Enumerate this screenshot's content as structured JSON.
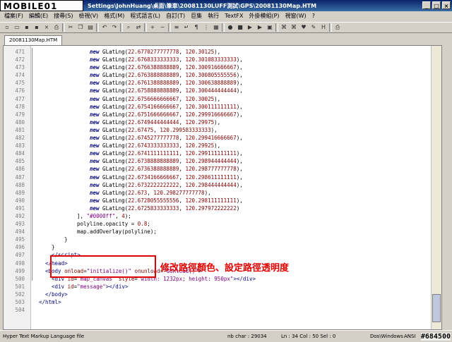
{
  "window": {
    "logo": "MOBILE01",
    "title": "Settings\\JohnHuang\\桌面\\筆車\\20081130LUFF測試\\GPS\\20081130Map.HTM"
  },
  "menu": [
    "檔案(F)",
    "編輯(E)",
    "搜尋(S)",
    "檢視(V)",
    "格式(M)",
    "程式語言(L)",
    "自訂(T)",
    "巨集",
    "執行",
    "TextFX",
    "外掛模組(P)",
    "視窗(W)",
    "?"
  ],
  "tab": {
    "label": "20081130Map.HTM"
  },
  "lines": [
    {
      "n": 471,
      "html": "<span class='kw'>new</span> GLatLng(<span class='num'>22.6770277777778</span>, <span class='num'>120.30125</span>),",
      "indent": 8
    },
    {
      "n": 472,
      "html": "<span class='kw'>new</span> GLatLng(<span class='num'>22.6768333333333</span>, <span class='num'>120.301083333333</span>),",
      "indent": 8
    },
    {
      "n": 473,
      "html": "<span class='kw'>new</span> GLatLng(<span class='num'>22.6766388888889</span>, <span class='num'>120.300916666667</span>),",
      "indent": 8
    },
    {
      "n": 474,
      "html": "<span class='kw'>new</span> GLatLng(<span class='num'>22.6763888888889</span>, <span class='num'>120.300805555556</span>),",
      "indent": 8
    },
    {
      "n": 475,
      "html": "<span class='kw'>new</span> GLatLng(<span class='num'>22.6761388888889</span>, <span class='num'>120.300638888889</span>),",
      "indent": 8
    },
    {
      "n": 476,
      "html": "<span class='kw'>new</span> GLatLng(<span class='num'>22.6758888888889</span>, <span class='num'>120.300444444444</span>),",
      "indent": 8
    },
    {
      "n": 477,
      "html": "<span class='kw'>new</span> GLatLng(<span class='num'>22.6756666666667</span>, <span class='num'>120.30025</span>),",
      "indent": 8
    },
    {
      "n": 478,
      "html": "<span class='kw'>new</span> GLatLng(<span class='num'>22.6754166666667</span>, <span class='num'>120.300111111111</span>),",
      "indent": 8
    },
    {
      "n": 479,
      "html": "<span class='kw'>new</span> GLatLng(<span class='num'>22.6751666666667</span>, <span class='num'>120.299916666667</span>),",
      "indent": 8
    },
    {
      "n": 480,
      "html": "<span class='kw'>new</span> GLatLng(<span class='num'>22.6749444444444</span>, <span class='num'>120.29975</span>),",
      "indent": 8
    },
    {
      "n": 481,
      "html": "<span class='kw'>new</span> GLatLng(<span class='num'>22.67475</span>, <span class='num'>120.299583333333</span>),",
      "indent": 8
    },
    {
      "n": 482,
      "html": "<span class='kw'>new</span> GLatLng(<span class='num'>22.6745277777778</span>, <span class='num'>120.299416666667</span>),",
      "indent": 8
    },
    {
      "n": 483,
      "html": "<span class='kw'>new</span> GLatLng(<span class='num'>22.6743333333333</span>, <span class='num'>120.29925</span>),",
      "indent": 8
    },
    {
      "n": 484,
      "html": "<span class='kw'>new</span> GLatLng(<span class='num'>22.6741111111111</span>, <span class='num'>120.299111111111</span>),",
      "indent": 8
    },
    {
      "n": 485,
      "html": "<span class='kw'>new</span> GLatLng(<span class='num'>22.6738888888889</span>, <span class='num'>120.298944444444</span>),",
      "indent": 8
    },
    {
      "n": 486,
      "html": "<span class='kw'>new</span> GLatLng(<span class='num'>22.6736388888889</span>, <span class='num'>120.298777777778</span>),",
      "indent": 8
    },
    {
      "n": 487,
      "html": "<span class='kw'>new</span> GLatLng(<span class='num'>22.6734166666667</span>, <span class='num'>120.298611111111</span>),",
      "indent": 8
    },
    {
      "n": 488,
      "html": "<span class='kw'>new</span> GLatLng(<span class='num'>22.6732222222222</span>, <span class='num'>120.298444444444</span>),",
      "indent": 8
    },
    {
      "n": 489,
      "html": "<span class='kw'>new</span> GLatLng(<span class='num'>22.673</span>, <span class='num'>120.298277777778</span>),",
      "indent": 8
    },
    {
      "n": 490,
      "html": "<span class='kw'>new</span> GLatLng(<span class='num'>22.6728055555556</span>, <span class='num'>120.298111111111</span>),",
      "indent": 8
    },
    {
      "n": 491,
      "html": "<span class='kw'>new</span> GLatLng(<span class='num'>22.6725833333333</span>, <span class='num'>120.297972222222</span>)",
      "indent": 8
    },
    {
      "n": 492,
      "html": "], <span class='str'>\"#0000ff\"</span>, <span class='num'>4</span>);",
      "indent": 6
    },
    {
      "n": 493,
      "html": "polyline.opacity = <span class='num'>0.8</span>;",
      "indent": 6
    },
    {
      "n": 494,
      "html": "map.addOverlay(polyline);",
      "indent": 6
    },
    {
      "n": 495,
      "html": "}",
      "indent": 4
    },
    {
      "n": 496,
      "html": "}",
      "indent": 2
    },
    {
      "n": 497,
      "html": "<span class='tag'>&lt;/script&gt;</span>",
      "indent": 2
    },
    {
      "n": 498,
      "html": "<span class='tag'>&lt;/head&gt;</span>",
      "indent": 1
    },
    {
      "n": 499,
      "html": "<span class='tag'>&lt;body</span> <span class='attr'>onload</span>=<span class='aval'>\"initialize()\"</span> <span class='attr'>onunload</span>=<span class='aval'>\"GUnload()\"</span><span class='tag'>&gt;</span>",
      "indent": 1
    },
    {
      "n": 500,
      "html": "<span class='tag'>&lt;div</span> <span class='attr'>id</span>=<span class='aval'>\"map_canvas\"</span> <span class='attr'>style</span>=<span class='aval'>\"width: 1232px; height: 950px\"</span><span class='tag'>&gt;&lt;/div&gt;</span>",
      "indent": 2
    },
    {
      "n": 501,
      "html": "<span class='tag'>&lt;div</span> <span class='attr'>id</span>=<span class='aval'>\"message\"</span><span class='tag'>&gt;&lt;/div&gt;</span>",
      "indent": 2
    },
    {
      "n": 502,
      "html": "<span class='tag'>&lt;/body&gt;</span>",
      "indent": 1
    },
    {
      "n": 503,
      "html": "<span class='tag'>&lt;/html&gt;</span>",
      "indent": 0
    },
    {
      "n": 504,
      "html": "",
      "indent": 0
    }
  ],
  "annotation": "修改路徑顏色、設定路徑透明度",
  "status": {
    "type": "Hyper Text Markup Language file",
    "chars": "nb char : 29034",
    "pos": "Ln : 34   Col : 50   Sel : 0",
    "eol": "Dos\\Windows",
    "enc": "ANSI",
    "watermark": "#684500"
  }
}
